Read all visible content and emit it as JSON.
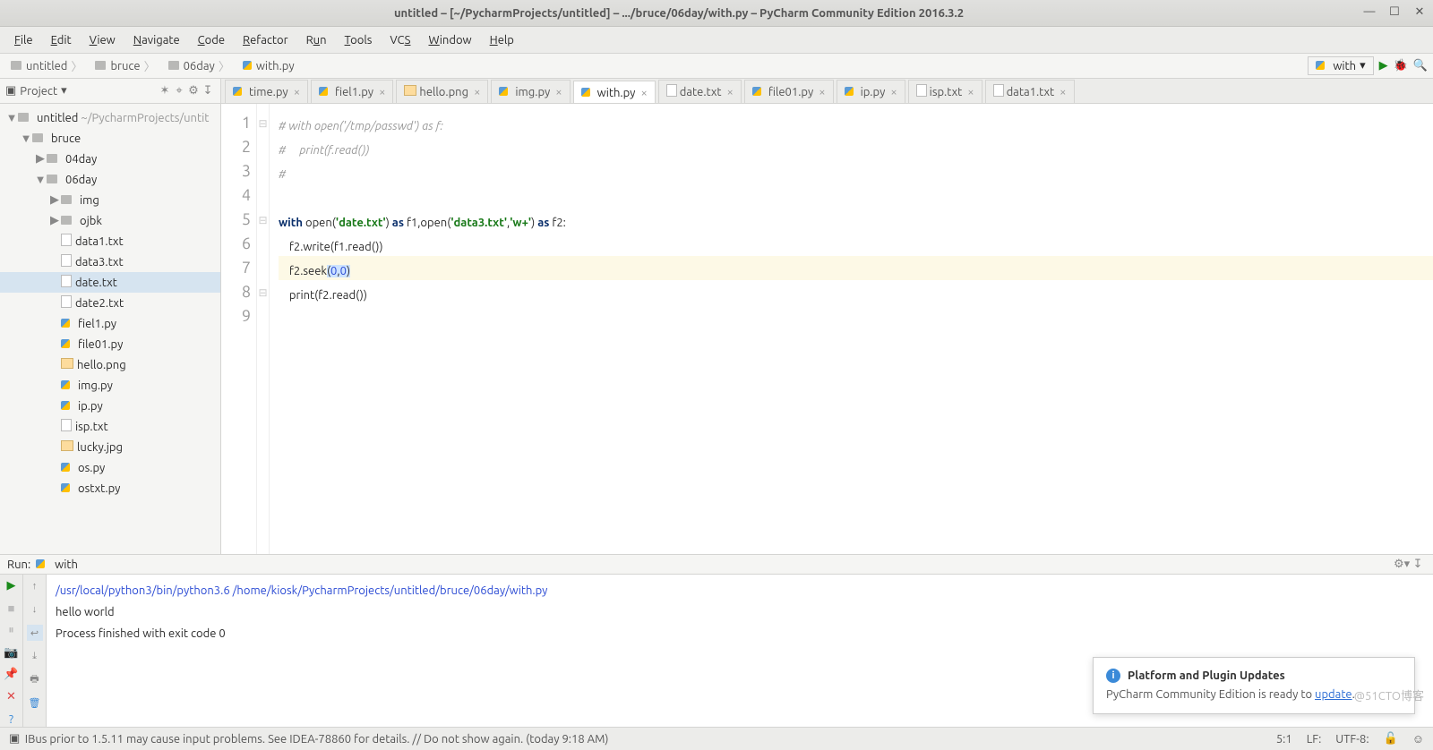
{
  "window": {
    "title": "untitled – [~/PycharmProjects/untitled] – .../bruce/06day/with.py – PyCharm Community Edition 2016.3.2"
  },
  "menu": [
    "File",
    "Edit",
    "View",
    "Navigate",
    "Code",
    "Refactor",
    "Run",
    "Tools",
    "VCS",
    "Window",
    "Help"
  ],
  "breadcrumb": [
    {
      "label": "untitled",
      "icon": "dir"
    },
    {
      "label": "bruce",
      "icon": "dir"
    },
    {
      "label": "06day",
      "icon": "dir"
    },
    {
      "label": "with.py",
      "icon": "py"
    }
  ],
  "runconf": {
    "label": "with"
  },
  "project": {
    "title": "Project",
    "root": {
      "name": "untitled",
      "path": "~/PycharmProjects/untit"
    },
    "tree": [
      {
        "d": 0,
        "arrow": "▼",
        "icon": "dir",
        "name": "untitled",
        "suffix": " ~/PycharmProjects/untit"
      },
      {
        "d": 1,
        "arrow": "▼",
        "icon": "dir",
        "name": "bruce"
      },
      {
        "d": 2,
        "arrow": "▶",
        "icon": "dir",
        "name": "04day"
      },
      {
        "d": 2,
        "arrow": "▼",
        "icon": "dir",
        "name": "06day"
      },
      {
        "d": 3,
        "arrow": "▶",
        "icon": "dir",
        "name": "img"
      },
      {
        "d": 3,
        "arrow": "▶",
        "icon": "dir",
        "name": "ojbk"
      },
      {
        "d": 3,
        "arrow": "",
        "icon": "txt",
        "name": "data1.txt"
      },
      {
        "d": 3,
        "arrow": "",
        "icon": "txt",
        "name": "data3.txt"
      },
      {
        "d": 3,
        "arrow": "",
        "icon": "txt",
        "name": "date.txt",
        "selected": true
      },
      {
        "d": 3,
        "arrow": "",
        "icon": "txt",
        "name": "date2.txt"
      },
      {
        "d": 3,
        "arrow": "",
        "icon": "py",
        "name": "fiel1.py"
      },
      {
        "d": 3,
        "arrow": "",
        "icon": "py",
        "name": "file01.py"
      },
      {
        "d": 3,
        "arrow": "",
        "icon": "img",
        "name": "hello.png"
      },
      {
        "d": 3,
        "arrow": "",
        "icon": "py",
        "name": "img.py"
      },
      {
        "d": 3,
        "arrow": "",
        "icon": "py",
        "name": "ip.py"
      },
      {
        "d": 3,
        "arrow": "",
        "icon": "txt",
        "name": "isp.txt"
      },
      {
        "d": 3,
        "arrow": "",
        "icon": "img",
        "name": "lucky.jpg"
      },
      {
        "d": 3,
        "arrow": "",
        "icon": "py",
        "name": "os.py"
      },
      {
        "d": 3,
        "arrow": "",
        "icon": "py",
        "name": "ostxt.py"
      }
    ]
  },
  "tabs": [
    {
      "label": "time.py",
      "icon": "py"
    },
    {
      "label": "fiel1.py",
      "icon": "py"
    },
    {
      "label": "hello.png",
      "icon": "img"
    },
    {
      "label": "img.py",
      "icon": "py"
    },
    {
      "label": "with.py",
      "icon": "py",
      "active": true
    },
    {
      "label": "date.txt",
      "icon": "txt"
    },
    {
      "label": "file01.py",
      "icon": "py"
    },
    {
      "label": "ip.py",
      "icon": "py"
    },
    {
      "label": "isp.txt",
      "icon": "txt"
    },
    {
      "label": "data1.txt",
      "icon": "txt"
    }
  ],
  "editor": {
    "lines": [
      "1",
      "2",
      "3",
      "4",
      "5",
      "6",
      "7",
      "8",
      "9"
    ],
    "code": {
      "l1": "# with open('/tmp/passwd') as f:",
      "l2": "#     print(f.read())",
      "l3": "#",
      "l5_kw1": "with",
      "l5_fn1": " open(",
      "l5_str1": "'date.txt'",
      "l5_p1": ") ",
      "l5_kw2": "as",
      "l5_p2": " f1,",
      "l5_fn2": "open(",
      "l5_str2": "'data3.txt'",
      "l5_c1": ",",
      "l5_str3": "'w+'",
      "l5_p3": ") ",
      "l5_kw3": "as",
      "l5_p4": " f2:",
      "l6": "    f2.write(f1.read())",
      "l7a": "    f2.seek",
      "l7b": "(",
      "l7c": "0",
      "l7d": ",",
      "l7e": "0",
      "l7f": ")",
      "l8": "    print(f2.read())"
    },
    "current_line": 7
  },
  "run": {
    "title": "Run:",
    "config": "with",
    "console": [
      {
        "cls": "blue",
        "text": "/usr/local/python3/bin/python3.6 /home/kiosk/PycharmProjects/untitled/bruce/06day/with.py"
      },
      {
        "cls": "",
        "text": "hello world"
      },
      {
        "cls": "",
        "text": ""
      },
      {
        "cls": "",
        "text": "Process finished with exit code 0"
      }
    ]
  },
  "notification": {
    "title": "Platform and Plugin Updates",
    "body_pre": "PyCharm Community Edition is ready to ",
    "link": "update",
    "body_post": "."
  },
  "status": {
    "msg": "IBus prior to 1.5.11 may cause input problems. See IDEA-78860 for details. // Do not show again. (today 9:18 AM)",
    "pos": "5:1",
    "sep": "LF:",
    "enc": "UTF-8:"
  },
  "watermark": "@51CTO博客"
}
